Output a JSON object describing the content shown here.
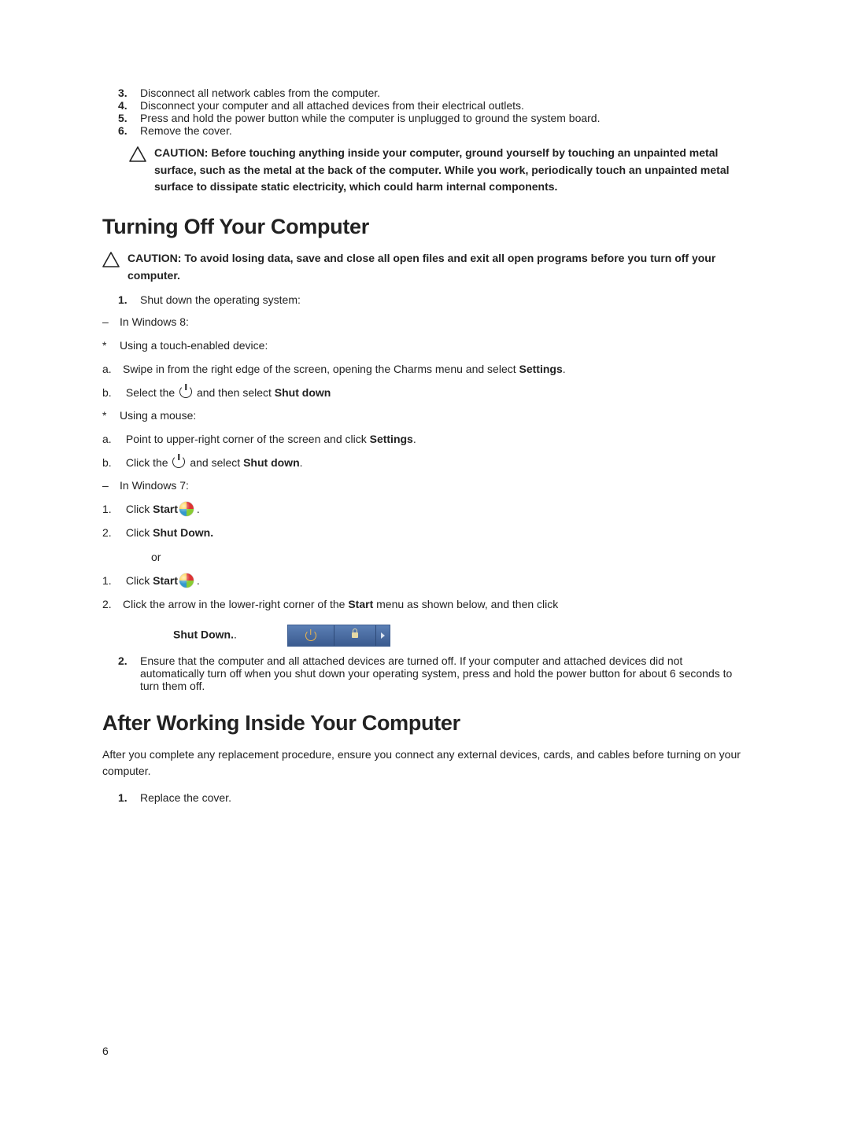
{
  "steps_top": [
    {
      "n": "3.",
      "t": "Disconnect all network cables from the computer."
    },
    {
      "n": "4.",
      "t": "Disconnect your computer and all attached devices from their electrical outlets."
    },
    {
      "n": "5.",
      "t": "Press and hold the power button while the computer is unplugged to ground the system board."
    },
    {
      "n": "6.",
      "t": "Remove the cover."
    }
  ],
  "caution1_label": "CAUTION: ",
  "caution1_text": "Before touching anything inside your computer, ground yourself by touching an unpainted metal surface, such as the metal at the back of the computer. While you work, periodically touch an unpainted metal surface to dissipate static electricity, which could harm internal components.",
  "heading1": "Turning Off Your Computer",
  "caution2_label": "CAUTION: ",
  "caution2_text": "To avoid losing data, save and close all open files and exit all open programs before you turn off your computer.",
  "s1": {
    "n": "1.",
    "t": "Shut down the operating system:"
  },
  "w8_label": "In Windows 8:",
  "touch_label": "Using a touch-enabled device:",
  "w8a_a": "Swipe in from the right edge of the screen, opening the Charms menu and select ",
  "w8a_a_bold": "Settings",
  "w8a_a_end": ".",
  "w8a_b_pre": "Select the ",
  "w8a_b_mid": " and then select ",
  "w8a_b_bold": "Shut down",
  "mouse_label": "Using a mouse:",
  "w8b_a_pre": "Point to upper-right corner of the screen and click ",
  "w8b_a_bold": "Settings",
  "w8b_a_end": ".",
  "w8b_b_pre": "Click the ",
  "w8b_b_mid": " and select ",
  "w8b_b_bold": "Shut down",
  "w8b_b_end": ".",
  "w7_label": "In Windows 7:",
  "w7_1_pre": "Click ",
  "w7_1_bold": "Start",
  "w7_1_end": " .",
  "w7_2_pre": "Click ",
  "w7_2_bold": "Shut Down.",
  "or": "or",
  "w7b_1_pre": "Click ",
  "w7b_1_bold": "Start",
  "w7b_1_end": " .",
  "w7b_2_pre": "Click the arrow in the lower-right corner of the ",
  "w7b_2_bold": "Start",
  "w7b_2_post": " menu as shown below, and then click ",
  "w7b_shutdown_bold": "Shut Down.",
  "w7b_shutdown_end": ".",
  "s2": {
    "n": "2.",
    "t": "Ensure that the computer and all attached devices are turned off. If your computer and attached devices did not automatically turn off when you shut down your operating system, press and hold the power button for about 6 seconds to turn them off."
  },
  "heading2": "After Working Inside Your Computer",
  "after_para": "After you complete any replacement procedure, ensure you connect any external devices, cards, and cables before turning on your computer.",
  "after_s1": {
    "n": "1.",
    "t": "Replace the cover."
  },
  "page_number": "6",
  "markers": {
    "dash": "–",
    "star": "*",
    "a": "a.",
    "b": "b.",
    "n1": "1.",
    "n2": "2."
  }
}
